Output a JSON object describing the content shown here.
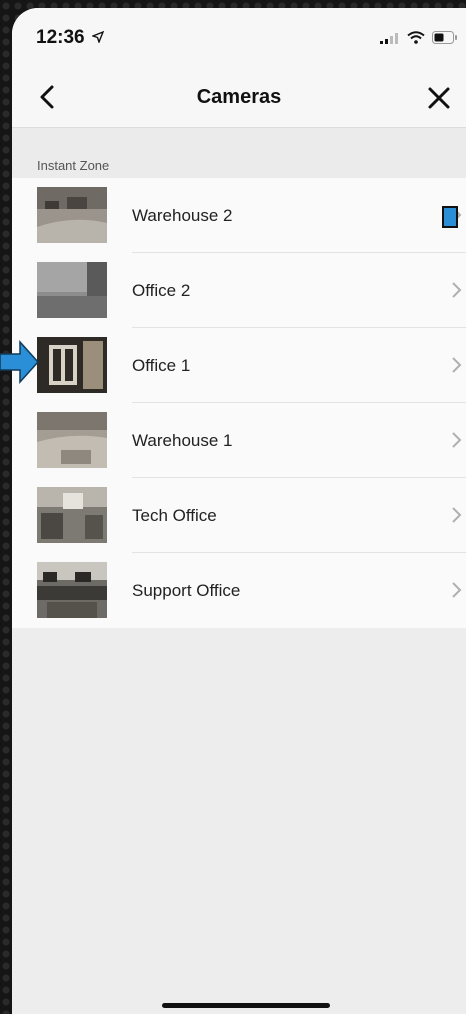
{
  "status_bar": {
    "time": "12:36"
  },
  "nav": {
    "title": "Cameras"
  },
  "section": {
    "label": "Instant Zone"
  },
  "cameras": [
    {
      "name": "Warehouse 2"
    },
    {
      "name": "Office 2"
    },
    {
      "name": "Office 1"
    },
    {
      "name": "Warehouse 1"
    },
    {
      "name": "Tech Office"
    },
    {
      "name": "Support Office"
    }
  ],
  "colors": {
    "accent": "#2a8fd6",
    "background": "#ededed",
    "row": "#fafafa"
  },
  "icons": {
    "back": "chevron-left-icon",
    "close": "close-icon",
    "row": "chevron-right-icon",
    "location": "location-arrow-icon",
    "signal": "signal-icon",
    "wifi": "wifi-icon",
    "battery": "battery-icon"
  }
}
